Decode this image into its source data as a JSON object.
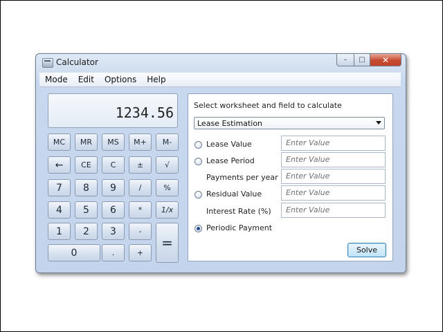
{
  "window": {
    "title": "Calculator",
    "controls": {
      "minimize": "–",
      "maximize": "□",
      "close": "✕"
    }
  },
  "menu": [
    "Mode",
    "Edit",
    "Options",
    "Help"
  ],
  "display": {
    "value": "1234.56"
  },
  "keypad": {
    "row1": [
      "MC",
      "MR",
      "MS",
      "M+",
      "M-"
    ],
    "row2": [
      "←",
      "CE",
      "C",
      "±",
      "√"
    ],
    "row3": [
      "7",
      "8",
      "9",
      "/",
      "%"
    ],
    "row4": [
      "4",
      "5",
      "6",
      "*",
      "1/x"
    ],
    "row5": [
      "1",
      "2",
      "3",
      "-"
    ],
    "row6": [
      "0",
      ".",
      "+"
    ],
    "equals": "="
  },
  "worksheet": {
    "label": "Select worksheet and field to calculate",
    "selected": "Lease Estimation",
    "fields": [
      {
        "label": "Lease Value",
        "radio": true,
        "selected": false,
        "placeholder": "Enter Value"
      },
      {
        "label": "Lease Period",
        "radio": true,
        "selected": false,
        "placeholder": "Enter Value"
      },
      {
        "label": "Payments per year",
        "radio": false,
        "selected": false,
        "placeholder": "Enter Value"
      },
      {
        "label": "Residual Value",
        "radio": true,
        "selected": false,
        "placeholder": "Enter Value"
      },
      {
        "label": "Interest Rate (%)",
        "radio": false,
        "selected": false,
        "placeholder": "Enter Value"
      },
      {
        "label": "Periodic Payment",
        "radio": true,
        "selected": true,
        "placeholder": ""
      }
    ],
    "solve_label": "Solve"
  }
}
